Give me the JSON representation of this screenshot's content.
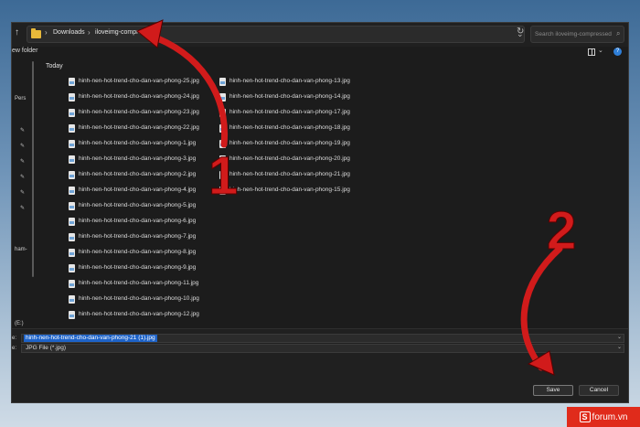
{
  "address_bar": {
    "breadcrumb": [
      "Downloads",
      "iloveimg-compressed"
    ],
    "search_placeholder": "Search iloveimg-compressed"
  },
  "toolbar": {
    "new_folder": "ew folder"
  },
  "nav_pane": {
    "labels": [
      "Pers",
      "ham-",
      "(E:)"
    ]
  },
  "file_list": {
    "group": "Today",
    "column1": [
      "hinh-nen-hot-trend-cho-dan-van-phong-25.jpg",
      "hinh-nen-hot-trend-cho-dan-van-phong-24.jpg",
      "hinh-nen-hot-trend-cho-dan-van-phong-23.jpg",
      "hinh-nen-hot-trend-cho-dan-van-phong-22.jpg",
      "hinh-nen-hot-trend-cho-dan-van-phong-1.jpg",
      "hinh-nen-hot-trend-cho-dan-van-phong-3.jpg",
      "hinh-nen-hot-trend-cho-dan-van-phong-2.jpg",
      "hinh-nen-hot-trend-cho-dan-van-phong-4.jpg",
      "hinh-nen-hot-trend-cho-dan-van-phong-5.jpg",
      "hinh-nen-hot-trend-cho-dan-van-phong-6.jpg",
      "hinh-nen-hot-trend-cho-dan-van-phong-7.jpg",
      "hinh-nen-hot-trend-cho-dan-van-phong-8.jpg",
      "hinh-nen-hot-trend-cho-dan-van-phong-9.jpg",
      "hinh-nen-hot-trend-cho-dan-van-phong-11.jpg",
      "hinh-nen-hot-trend-cho-dan-van-phong-10.jpg",
      "hinh-nen-hot-trend-cho-dan-van-phong-12.jpg"
    ],
    "column2": [
      "hinh-nen-hot-trend-cho-dan-van-phong-13.jpg",
      "hinh-nen-hot-trend-cho-dan-van-phong-14.jpg",
      "hinh-nen-hot-trend-cho-dan-van-phong-17.jpg",
      "hinh-nen-hot-trend-cho-dan-van-phong-18.jpg",
      "hinh-nen-hot-trend-cho-dan-van-phong-19.jpg",
      "hinh-nen-hot-trend-cho-dan-van-phong-20.jpg",
      "hinh-nen-hot-trend-cho-dan-van-phong-21.jpg",
      "hinh-nen-hot-trend-cho-dan-van-phong-15.jpg"
    ]
  },
  "save_panel": {
    "file_name_label": "e:",
    "file_name": "hinh-nen-hot-trend-cho-dan-van-phong-21 (1).jpg",
    "type_label": "e:",
    "file_type": "JPG File (*.jpg)",
    "save_label": "Save",
    "cancel_label": "Cancel"
  },
  "callouts": {
    "step1": "1",
    "step2": "2",
    "color": "#d11b1b"
  },
  "brand": {
    "name": "forum.vn",
    "mark": "S",
    "color": "#e02b1b"
  }
}
